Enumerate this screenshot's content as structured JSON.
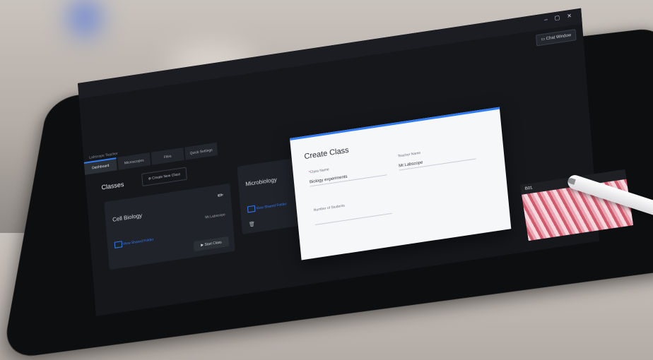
{
  "window": {
    "controls": "– ▢ ✕",
    "chat_button": "Chat Window",
    "app_title": "Labscope Teacher"
  },
  "tabs": [
    {
      "label": "Dashboard",
      "active": true
    },
    {
      "label": "Microscopes",
      "active": false
    },
    {
      "label": "Files",
      "active": false
    },
    {
      "label": "Quick Settings",
      "active": false
    }
  ],
  "classes": {
    "title": "Classes",
    "create_label": "Create New Class"
  },
  "cards": [
    {
      "name": "Cell Biology",
      "teacher": "Mr.Labscope",
      "link": "View Shared Folder",
      "start": "Start Class"
    },
    {
      "name": "Microbiology",
      "link": "View Shared Folder"
    }
  ],
  "modal": {
    "title": "Create Class",
    "class_name_label": "Class Name",
    "class_name_value": "Biology experiments",
    "teacher_name_label": "Teacher Name",
    "teacher_name_value": "Mr.Labscope",
    "students_label": "Number of Students"
  },
  "thumbnail": {
    "label": "B01"
  },
  "colors": {
    "accent": "#2f7bf5",
    "background": "#15171b"
  }
}
